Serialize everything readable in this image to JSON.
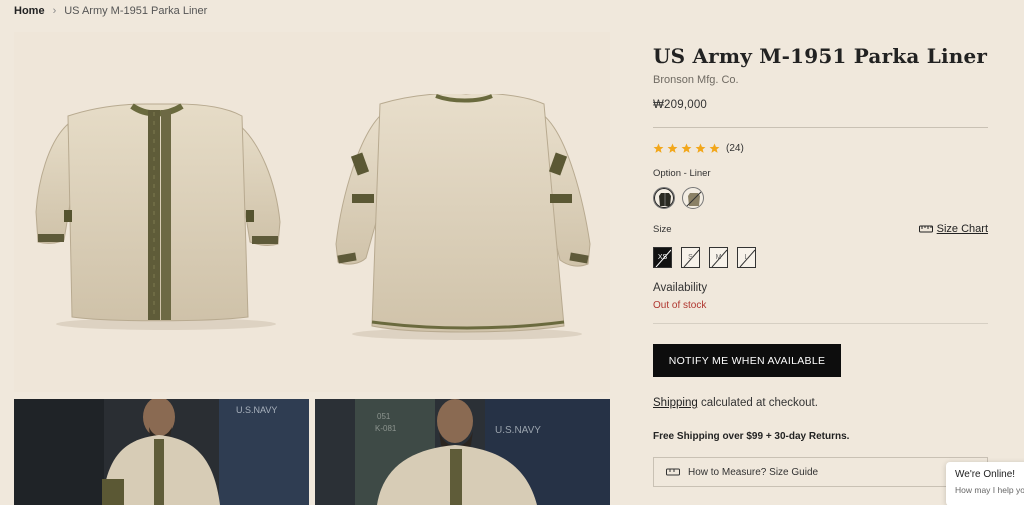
{
  "breadcrumb": {
    "home": "Home",
    "separator": "›",
    "current": "US Army M-1951 Parka Liner"
  },
  "gallery": {
    "images": [
      {
        "name": "parka-liner-front",
        "icon": "jacket-front-image"
      },
      {
        "name": "parka-liner-back",
        "icon": "jacket-back-image"
      },
      {
        "name": "model-photo-1",
        "icon": "model-photo",
        "caption": "U.S.NAVY"
      },
      {
        "name": "model-photo-2",
        "icon": "model-photo",
        "caption": "U.S.NAVY"
      }
    ]
  },
  "product": {
    "title": "US Army M-1951 Parka Liner",
    "vendor": "Bronson Mfg. Co.",
    "price": "₩209,000",
    "rating": {
      "stars": 5,
      "count": "(24)",
      "star_color": "#f2a71b"
    },
    "option": {
      "label": "Option - ",
      "value": "Liner",
      "swatches": [
        "Liner",
        "Parka"
      ]
    },
    "size": {
      "label": "Size",
      "chart_link": "Size Chart",
      "options": [
        "XS",
        "S",
        "M",
        "L"
      ],
      "selected": "XS"
    },
    "availability": {
      "label": "Availability",
      "status": "Out of stock",
      "status_color": "#b0362f"
    },
    "notify_button": "NOTIFY ME WHEN AVAILABLE",
    "shipping": {
      "link": "Shipping",
      "text": " calculated at checkout."
    },
    "free_shipping": "Free Shipping over $99 + 30-day Returns.",
    "measure_guide": "How to Measure? Size Guide"
  },
  "chat": {
    "title": "We're Online!",
    "subtitle": "How may I help you today?"
  },
  "colors": {
    "background": "#f0e8dc",
    "button": "#0d0d0d",
    "accent_red": "#b0362f"
  }
}
